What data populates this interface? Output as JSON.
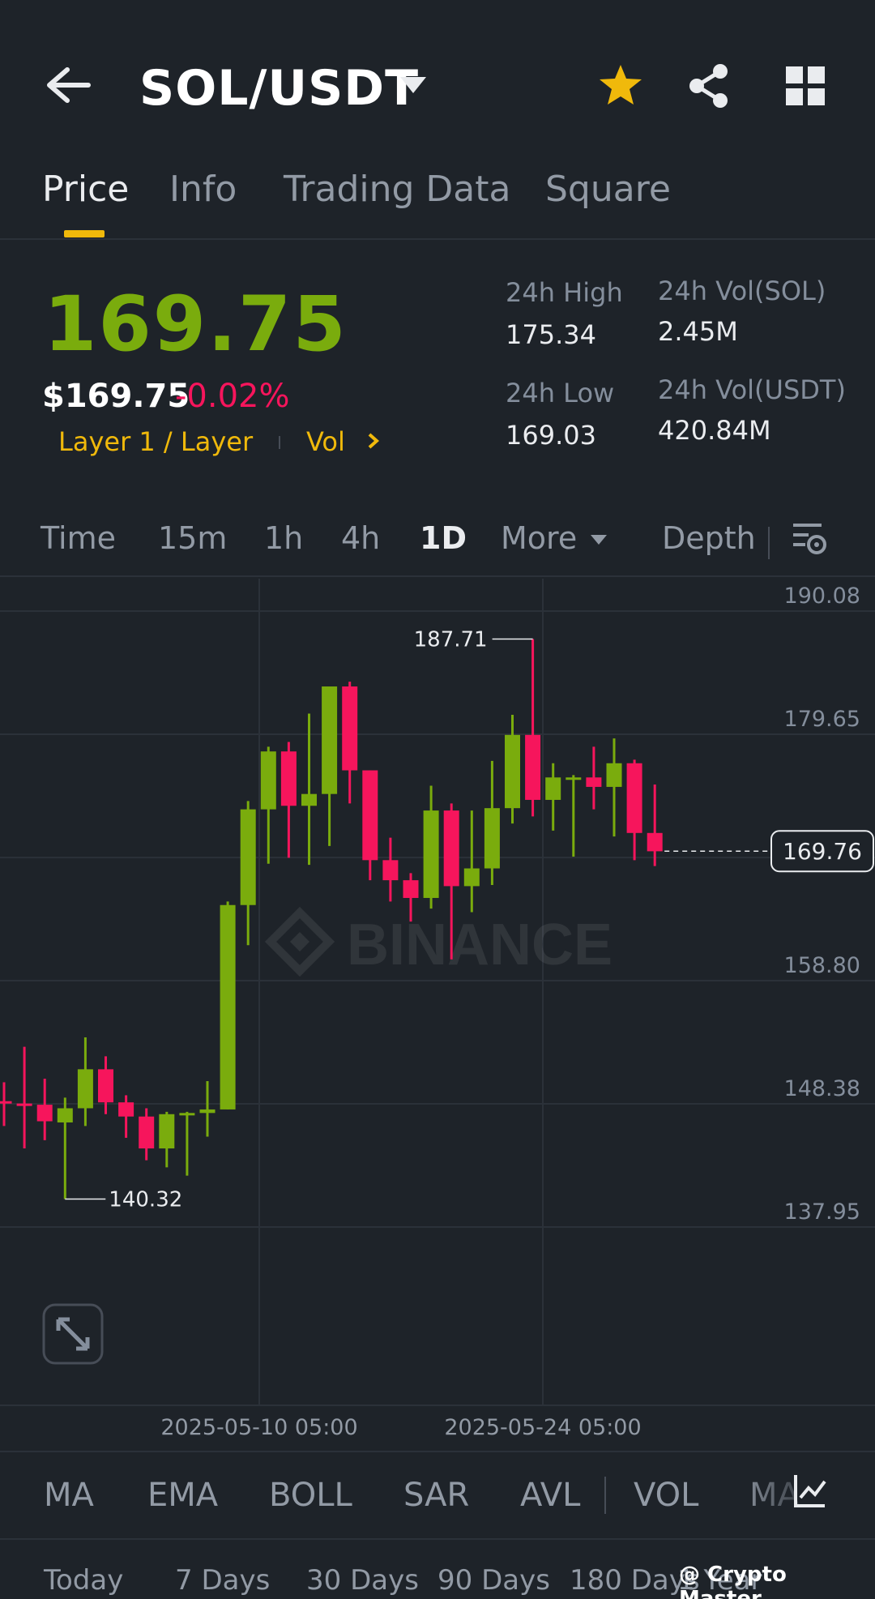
{
  "header": {
    "pair": "SOL/USDT",
    "icons": [
      "back-arrow-icon",
      "caret-down-icon",
      "star-icon",
      "share-icon",
      "grid-icon"
    ],
    "star_color": "#f0b90b"
  },
  "tabs": [
    {
      "label": "Price",
      "active": true
    },
    {
      "label": "Info",
      "active": false
    },
    {
      "label": "Trading Data",
      "active": false
    },
    {
      "label": "Square",
      "active": false
    }
  ],
  "ticker": {
    "last_price": "169.75",
    "usd_price": "$169.75",
    "change_pct": "-0.02%",
    "tag_layer": "Layer 1 / Layer",
    "tag_vol": "Vol",
    "high_label": "24h High",
    "high_value": "175.34",
    "low_label": "24h Low",
    "low_value": "169.03",
    "vol_sol_label": "24h Vol(SOL)",
    "vol_sol_value": "2.45M",
    "vol_usdt_label": "24h Vol(USDT)",
    "vol_usdt_value": "420.84M"
  },
  "intervals": {
    "items": [
      "Time",
      "15m",
      "1h",
      "4h",
      "1D",
      "More",
      "Depth"
    ],
    "active": "1D"
  },
  "colors": {
    "up": "#7aac0d",
    "down": "#f6155c",
    "accent": "#f0b90b",
    "background": "#1e2329"
  },
  "chart_data": {
    "type": "candlestick",
    "y_ticks": [
      "190.08",
      "179.65",
      "169.22",
      "158.80",
      "148.38",
      "137.95"
    ],
    "y_tick_labels_shown": [
      "190.08",
      "179.65",
      "158.80",
      "148.38",
      "137.95"
    ],
    "ylim": [
      137.95,
      190.08
    ],
    "x_tick_labels": [
      "2025-05-10 05:00",
      "2025-05-24 05:00"
    ],
    "current_price_label": "169.76",
    "current_price": 169.76,
    "max_annotation": "187.71",
    "min_annotation": "140.32",
    "watermark": "BINANCE",
    "candles": [
      {
        "o": 148.6,
        "h": 150.2,
        "l": 146.5,
        "c": 148.4
      },
      {
        "o": 148.4,
        "h": 153.2,
        "l": 144.6,
        "c": 148.3
      },
      {
        "o": 148.3,
        "h": 150.5,
        "l": 145.3,
        "c": 146.9
      },
      {
        "o": 146.8,
        "h": 148.9,
        "l": 140.32,
        "c": 148.0
      },
      {
        "o": 148.0,
        "h": 154.0,
        "l": 146.5,
        "c": 151.3
      },
      {
        "o": 151.3,
        "h": 152.4,
        "l": 147.5,
        "c": 148.5
      },
      {
        "o": 148.5,
        "h": 149.1,
        "l": 145.5,
        "c": 147.3
      },
      {
        "o": 147.3,
        "h": 148.0,
        "l": 143.6,
        "c": 144.6
      },
      {
        "o": 144.6,
        "h": 147.7,
        "l": 143.0,
        "c": 147.5
      },
      {
        "o": 147.5,
        "h": 147.7,
        "l": 142.3,
        "c": 147.6
      },
      {
        "o": 147.6,
        "h": 150.3,
        "l": 145.6,
        "c": 147.9
      },
      {
        "o": 147.9,
        "h": 165.5,
        "l": 147.9,
        "c": 165.2
      },
      {
        "o": 165.2,
        "h": 174.0,
        "l": 161.8,
        "c": 173.3
      },
      {
        "o": 173.3,
        "h": 178.6,
        "l": 168.7,
        "c": 178.2
      },
      {
        "o": 178.2,
        "h": 179.0,
        "l": 169.2,
        "c": 173.6
      },
      {
        "o": 173.6,
        "h": 181.4,
        "l": 168.6,
        "c": 174.6
      },
      {
        "o": 174.6,
        "h": 183.2,
        "l": 170.2,
        "c": 183.7
      },
      {
        "o": 183.7,
        "h": 184.1,
        "l": 173.8,
        "c": 176.6
      },
      {
        "o": 176.6,
        "h": 176.6,
        "l": 167.3,
        "c": 169.0
      },
      {
        "o": 169.0,
        "h": 170.9,
        "l": 165.5,
        "c": 167.3
      },
      {
        "o": 167.3,
        "h": 167.9,
        "l": 163.8,
        "c": 165.8
      },
      {
        "o": 165.8,
        "h": 175.3,
        "l": 164.9,
        "c": 173.2
      },
      {
        "o": 173.2,
        "h": 173.8,
        "l": 160.6,
        "c": 166.8
      },
      {
        "o": 166.8,
        "h": 173.2,
        "l": 164.6,
        "c": 168.3
      },
      {
        "o": 168.3,
        "h": 177.4,
        "l": 166.9,
        "c": 173.4
      },
      {
        "o": 173.4,
        "h": 181.3,
        "l": 172.1,
        "c": 179.6
      },
      {
        "o": 179.6,
        "h": 187.71,
        "l": 172.7,
        "c": 174.1
      },
      {
        "o": 174.1,
        "h": 177.2,
        "l": 171.5,
        "c": 176.0
      },
      {
        "o": 176.0,
        "h": 176.2,
        "l": 169.3,
        "c": 176.0
      },
      {
        "o": 176.0,
        "h": 178.6,
        "l": 173.3,
        "c": 175.2
      },
      {
        "o": 175.2,
        "h": 179.3,
        "l": 171.0,
        "c": 177.2
      },
      {
        "o": 177.2,
        "h": 177.5,
        "l": 169.0,
        "c": 171.3
      },
      {
        "o": 171.3,
        "h": 175.4,
        "l": 168.5,
        "c": 169.75
      }
    ]
  },
  "indicators": {
    "items": [
      "MA",
      "EMA",
      "BOLL",
      "SAR",
      "AVL",
      "VOL",
      "MA"
    ]
  },
  "periods": {
    "items": [
      "Today",
      "7 Days",
      "30 Days",
      "90 Days",
      "180 Days",
      "1 Year"
    ]
  },
  "watermark_credit": "@ Crypto  Master"
}
